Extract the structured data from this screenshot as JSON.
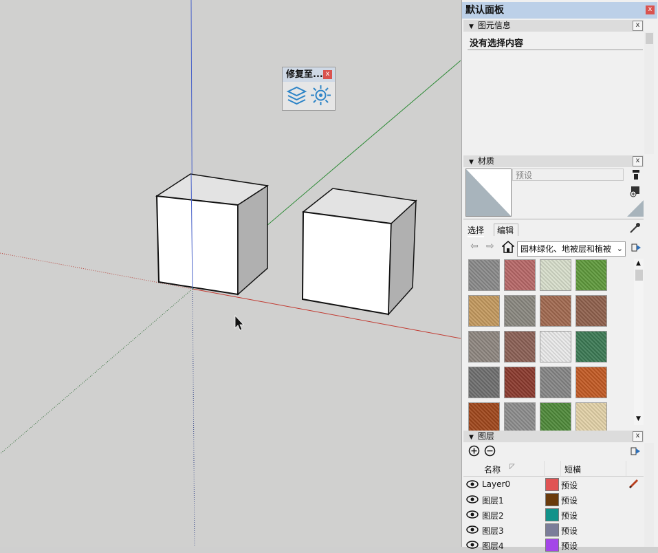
{
  "floating_toolbar": {
    "title": "修复至...",
    "close": "x",
    "icons": [
      "layers-icon",
      "sun-settings-icon"
    ]
  },
  "tray": {
    "title": "默认面板",
    "close": "x",
    "entity_info": {
      "title": "图元信息",
      "close": "x",
      "status": "没有选择内容"
    },
    "materials": {
      "title": "材质",
      "close": "x",
      "material_name": "预设",
      "tabs": [
        "选择",
        "编辑"
      ],
      "library": "园林绿化、地被层和植被",
      "swatches": [
        {
          "name": "gravel-gray",
          "color": "#8a8a8a"
        },
        {
          "name": "red-concrete",
          "color": "#b86868"
        },
        {
          "name": "stepping-stones",
          "color": "#d8dfcc"
        },
        {
          "name": "grass-green",
          "color": "#5f9a3c"
        },
        {
          "name": "sand-tan",
          "color": "#c49a5f"
        },
        {
          "name": "wood-fence",
          "color": "#8a8880"
        },
        {
          "name": "brown-pebbles",
          "color": "#a26a50"
        },
        {
          "name": "red-gravel",
          "color": "#90614d"
        },
        {
          "name": "mixed-stones",
          "color": "#8f8780"
        },
        {
          "name": "red-granite",
          "color": "#8c6156"
        },
        {
          "name": "wire-fence",
          "color": "#eaeaea"
        },
        {
          "name": "green-shrubs",
          "color": "#3c7a55"
        },
        {
          "name": "stone-blocks",
          "color": "#6f6f6f"
        },
        {
          "name": "rust-red",
          "color": "#8b3a2e"
        },
        {
          "name": "gray-boards",
          "color": "#868686"
        },
        {
          "name": "wood-lattice",
          "color": "#c35a24"
        },
        {
          "name": "wood-planks",
          "color": "#a0471c"
        },
        {
          "name": "fine-gravel",
          "color": "#8d8d8d"
        },
        {
          "name": "hedge-green",
          "color": "#4f8a3a"
        },
        {
          "name": "cream-stone",
          "color": "#e3d2a8"
        }
      ]
    },
    "layers": {
      "title": "图层",
      "close": "x",
      "columns": {
        "name": "名称",
        "style": "短横"
      },
      "rows": [
        {
          "name": "Layer0",
          "color": "#e05353",
          "style": "预设"
        },
        {
          "name": "图层1",
          "color": "#6a3b0c",
          "style": "预设"
        },
        {
          "name": "图层2",
          "color": "#12928a",
          "style": "预设"
        },
        {
          "name": "图层3",
          "color": "#7b7d99",
          "style": "预设"
        },
        {
          "name": "图层4",
          "color": "#a446e8",
          "style": "预设"
        }
      ]
    }
  }
}
